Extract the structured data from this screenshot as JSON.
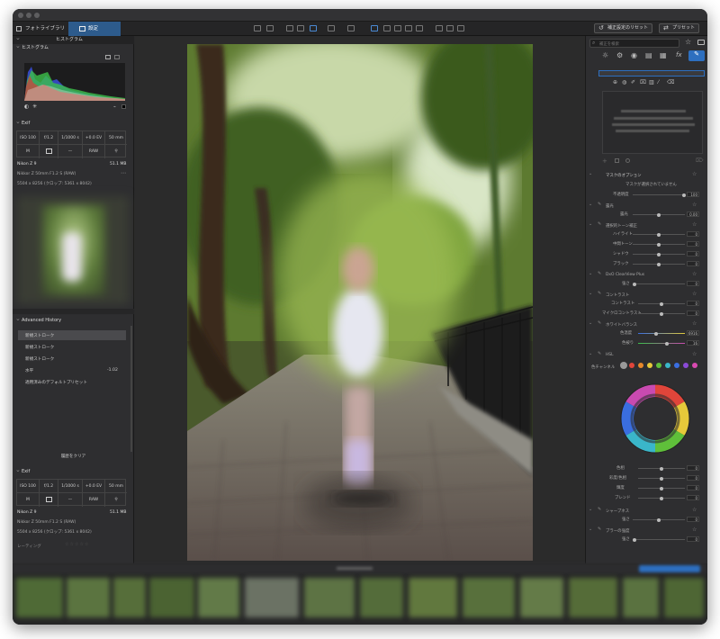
{
  "app": {
    "library_tab": "フォトライブラリ",
    "settings_tab": "設定"
  },
  "toolbar": {
    "reset_button": "補正設定のリセット",
    "preset_button": "プリセット"
  },
  "left": {
    "histogram_header": "ヒストグラム",
    "histogram_title": "ヒストグラム",
    "channels": [
      "RGB",
      "R",
      "G",
      "B",
      "L"
    ],
    "exif_header": "Exif",
    "exif": {
      "iso": "ISO 100",
      "aperture": "f/1.2",
      "shutter": "1/1000 s",
      "ev": "+0.0 EV",
      "focal": "50 mm",
      "mode": "M",
      "format": "RAW",
      "size": "51.1 MB",
      "camera": "Nikon Z 9",
      "lens": "Nikkor Z 50mm F1.2 S (RAW)",
      "dims": "5504 x 8256 (クロップ: 5361 x 8042)"
    },
    "history_header": "Advanced History",
    "history": [
      "新規ストローク",
      "新規ストローク",
      "新規ストローク",
      "水平",
      "適用済みのデフォルトプリセット"
    ],
    "history_value": "-1.02",
    "clear_button": "履歴をクリア",
    "exif2_header": "Exif",
    "rating_label": "レーティング"
  },
  "right": {
    "search_placeholder": "補正を検索",
    "mask_title": "マスクのオプション",
    "mask_note": "マスクが選択されていません",
    "opacity_label": "不透明度",
    "opacity_value": "100",
    "exposure_section": "露光",
    "exposure_label": "露光",
    "exposure_value": "0.00",
    "tone_section": "選択的トーン補正",
    "tone_rows": [
      {
        "label": "ハイライト",
        "value": "0"
      },
      {
        "label": "中間トーン",
        "value": "0"
      },
      {
        "label": "シャドウ",
        "value": "0"
      },
      {
        "label": "ブラック",
        "value": "0"
      }
    ],
    "clearview_section": "DxO ClearView Plus",
    "clearview_label": "強さ",
    "clearview_value": "0",
    "contrast_section": "コントラスト",
    "contrast_rows": [
      {
        "label": "コントラスト",
        "value": "0"
      },
      {
        "label": "マイクロコントラスト",
        "value": "0"
      }
    ],
    "wb_section": "ホワイトバランス",
    "wb_rows": [
      {
        "label": "色温度",
        "value": "6916"
      },
      {
        "label": "色被り",
        "value": "16"
      }
    ],
    "hsl_section": "HSL",
    "hsl_channel_label": "色チャンネル",
    "hsl_rows": [
      {
        "label": "色相",
        "value": "0"
      },
      {
        "label": "彩度/色相",
        "value": "0"
      },
      {
        "label": "輝度",
        "value": "0"
      },
      {
        "label": "ブレンド",
        "value": "0"
      }
    ],
    "sharpen_section": "シャープネス",
    "sharpen_label": "強さ",
    "sharpen_value": "0",
    "blur_section": "ブラーの強度",
    "blur_label": "強さ",
    "blur_value": "0",
    "hsl_colors": [
      "#999999",
      "#e0453a",
      "#e8882a",
      "#e6c93a",
      "#5fbf3a",
      "#3ab6c9",
      "#3a6ee0",
      "#8a4ad6",
      "#d94ab0"
    ],
    "accent_color": "#2d6fbf"
  }
}
